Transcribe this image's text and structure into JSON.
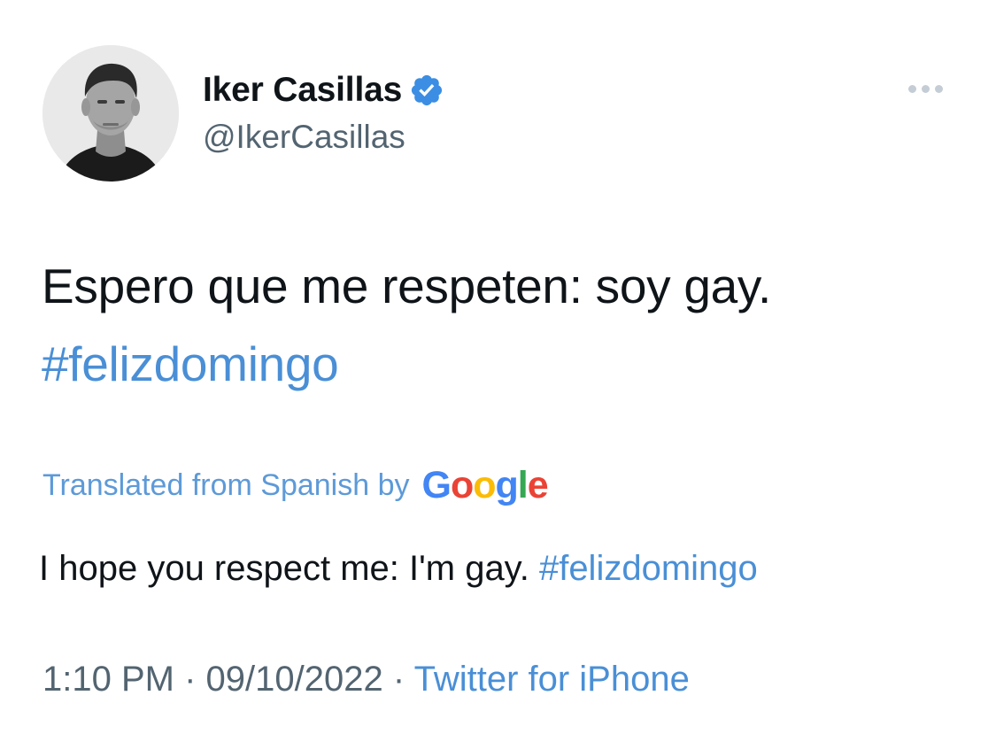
{
  "author": {
    "display_name": "Iker Casillas",
    "handle": "@IkerCasillas",
    "verified": true
  },
  "tweet": {
    "text": "Espero que me respeten: soy gay.",
    "hashtag": "#felizdomingo"
  },
  "translation": {
    "label": "Translated from Spanish by",
    "provider": "Google",
    "text": "I hope you respect me: I'm gay.",
    "hashtag": "#felizdomingo"
  },
  "meta": {
    "time": "1:10 PM",
    "separator": "·",
    "date": "09/10/2022",
    "source": "Twitter for iPhone"
  },
  "colors": {
    "link": "#4a8fd6",
    "verified": "#3b8ee3",
    "secondary_text": "#536471",
    "primary_text": "#0f1419"
  },
  "icons": {
    "more": "more-icon",
    "verified": "verified-badge-icon"
  }
}
